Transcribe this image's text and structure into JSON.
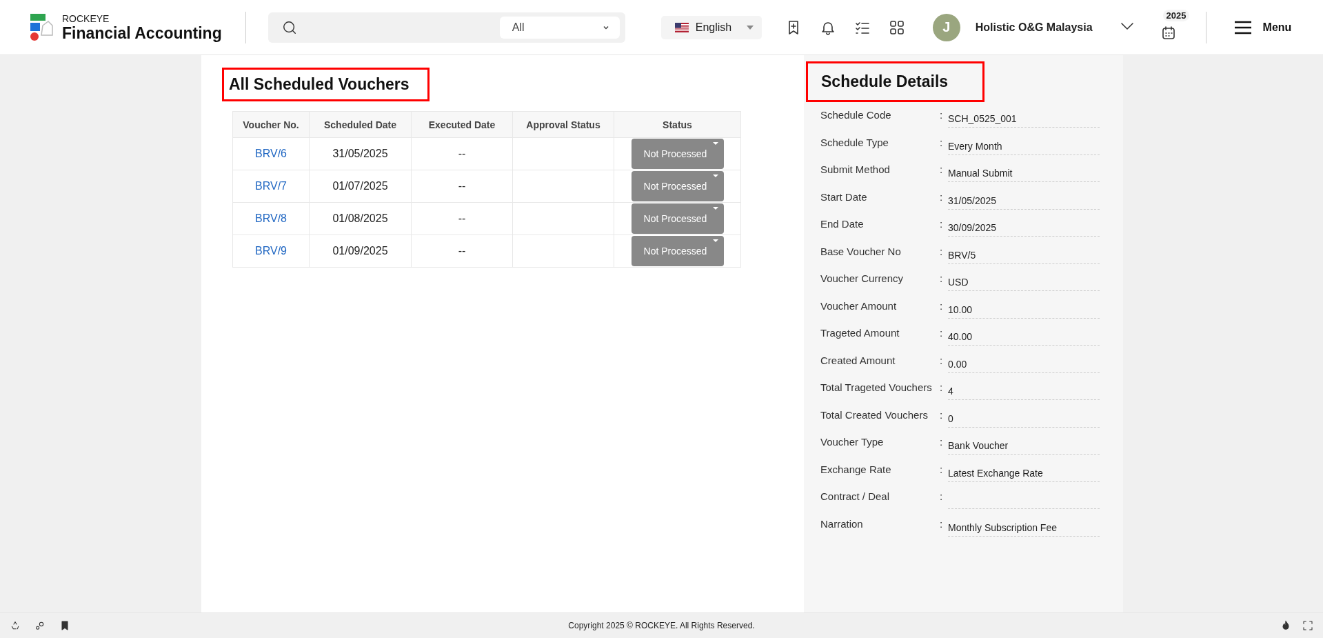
{
  "header": {
    "brand_small": "ROCKEYE",
    "brand": "Financial Accounting",
    "search_filter": "All",
    "language": "English",
    "avatar_initial": "J",
    "company": "Holistic O&G Malaysia",
    "year": "2025",
    "menu_label": "Menu"
  },
  "vouchers": {
    "title": "All Scheduled Vouchers",
    "columns": [
      "Voucher No.",
      "Scheduled Date",
      "Executed Date",
      "Approval Status",
      "Status"
    ],
    "rows": [
      {
        "voucher_no": "BRV/6",
        "scheduled_date": "31/05/2025",
        "executed_date": "--",
        "status": "Not Processed"
      },
      {
        "voucher_no": "BRV/7",
        "scheduled_date": "01/07/2025",
        "executed_date": "--",
        "status": "Not Processed"
      },
      {
        "voucher_no": "BRV/8",
        "scheduled_date": "01/08/2025",
        "executed_date": "--",
        "status": "Not Processed"
      },
      {
        "voucher_no": "BRV/9",
        "scheduled_date": "01/09/2025",
        "executed_date": "--",
        "status": "Not Processed"
      }
    ]
  },
  "details": {
    "title": "Schedule Details",
    "fields": [
      {
        "label": "Schedule Code",
        "separator": ":",
        "value": "SCH_0525_001"
      },
      {
        "label": "Schedule Type",
        "separator": ":",
        "value": "Every Month"
      },
      {
        "label": "Submit Method",
        "separator": ":",
        "value": "Manual Submit"
      },
      {
        "label": "Start Date",
        "separator": ":",
        "value": "31/05/2025"
      },
      {
        "label": "End Date",
        "separator": ":",
        "value": "30/09/2025"
      },
      {
        "label": "Base Voucher No",
        "separator": ":",
        "value": "BRV/5"
      },
      {
        "label": "Voucher Currency",
        "separator": ":",
        "value": "USD"
      },
      {
        "label": "Voucher Amount",
        "separator": ":",
        "value": "10.00"
      },
      {
        "label": "Trageted Amount",
        "separator": ":",
        "value": "40.00"
      },
      {
        "label": "Created Amount",
        "separator": ":",
        "value": "0.00"
      },
      {
        "label": "Total Trageted Vouchers",
        "separator": ":",
        "value": "4"
      },
      {
        "label": "Total Created Vouchers",
        "separator": ":",
        "value": "0"
      },
      {
        "label": "Voucher Type",
        "separator": ":",
        "value": "Bank Voucher"
      },
      {
        "label": "Exchange Rate",
        "separator": ":",
        "value": "Latest Exchange Rate"
      },
      {
        "label": "Contract / Deal",
        "separator": ":"
      },
      {
        "label": "Narration",
        "separator": ":",
        "value": "Monthly Subscription Fee"
      }
    ]
  },
  "footer": {
    "copyright": "Copyright 2025 © ROCKEYE. All Rights Reserved."
  }
}
